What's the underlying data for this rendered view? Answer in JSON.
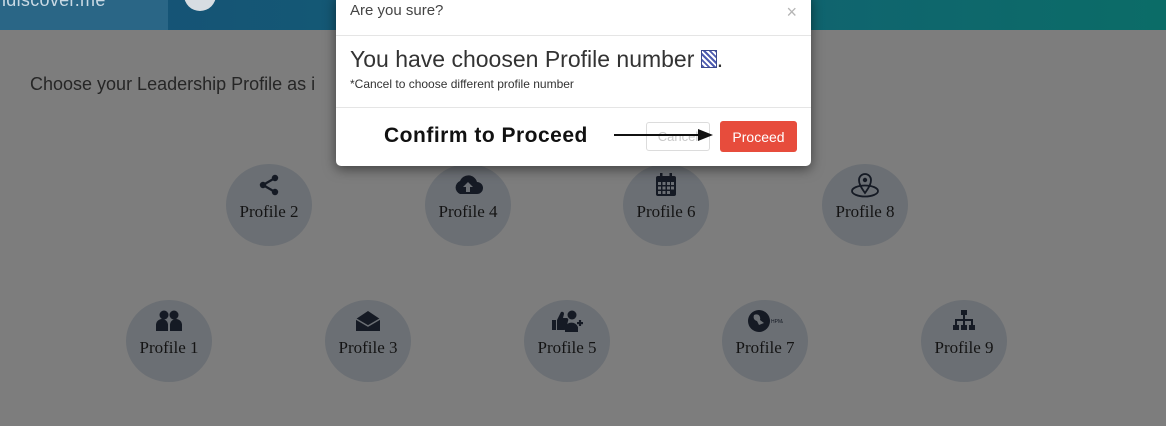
{
  "app": {
    "brand": "idiscover.me"
  },
  "page": {
    "instruction": "Choose your Leadership Profile as i"
  },
  "profiles": [
    {
      "label": "Profile 2",
      "icon": "share-icon"
    },
    {
      "label": "Profile 4",
      "icon": "cloud-upload-icon"
    },
    {
      "label": "Profile 6",
      "icon": "calendar-icon"
    },
    {
      "label": "Profile 8",
      "icon": "map-marker-icon"
    },
    {
      "label": "Profile 1",
      "icon": "users-icon"
    },
    {
      "label": "Profile 3",
      "icon": "envelope-icon"
    },
    {
      "label": "Profile 5",
      "icon": "thumbs-up-user-add-icon"
    },
    {
      "label": "Profile 7",
      "icon": "eagle-seal-icon"
    },
    {
      "label": "Profile 9",
      "icon": "sitemap-icon"
    }
  ],
  "modal": {
    "title": "Are you sure?",
    "close_label": "×",
    "message": "You have choosen Profile number",
    "message_suffix": ".",
    "note": "*Cancel to choose different profile number",
    "cancel_label": "Cancel",
    "proceed_label": "Proceed",
    "annotation": "Confirm to Proceed"
  },
  "colors": {
    "proceed": "#e74c3c",
    "header_start": "#164f76",
    "header_end": "#0b6c67",
    "overlay": "#7e7e7e"
  }
}
